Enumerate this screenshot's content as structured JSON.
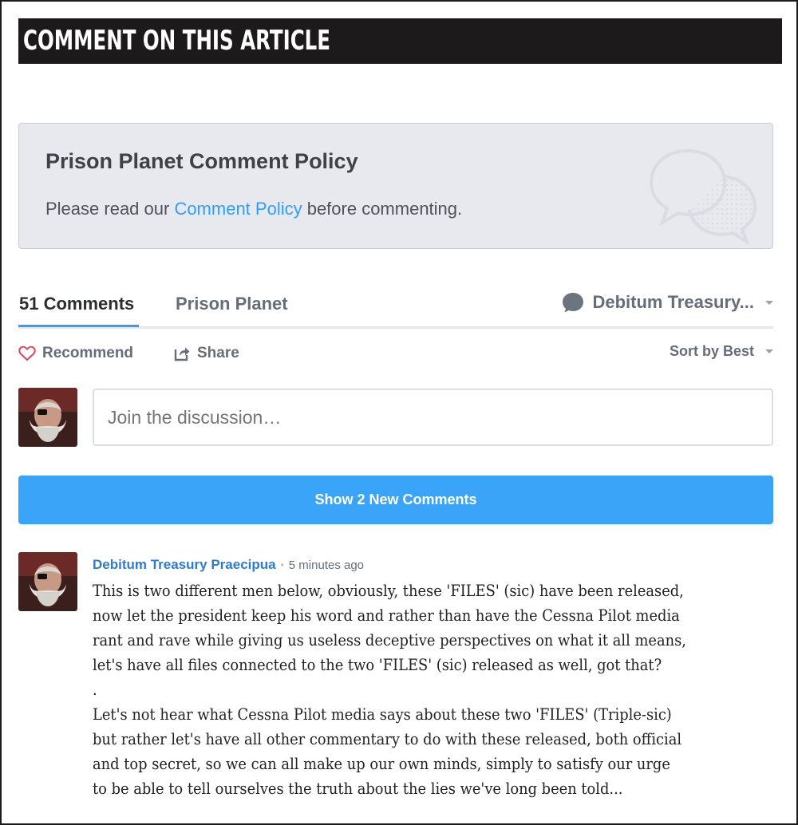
{
  "header": {
    "title": "COMMENT ON THIS ARTICLE"
  },
  "policy": {
    "title": "Prison Planet Comment Policy",
    "text_before": "Please read our ",
    "link": "Comment Policy",
    "text_after": " before commenting.",
    "icon": "speech-bubbles-icon"
  },
  "tabs": {
    "comments": "51 Comments",
    "community": "Prison Planet",
    "user": "Debitum Treasury..."
  },
  "actions": {
    "recommend": "Recommend",
    "share": "Share",
    "sort": "Sort by Best"
  },
  "composer": {
    "placeholder": "Join the discussion…"
  },
  "new_comments_button": "Show 2 New Comments",
  "post": {
    "author": "Debitum Treasury Praecipua",
    "separator": "•",
    "time": "5 minutes ago",
    "lines": [
      "This is two different men below, obviously, these 'FILES' (sic) have been released,",
      "now let the president keep his word and rather than have the Cessna Pilot media",
      "rant and rave while giving us useless deceptive perspectives on what it all means,",
      "let's have all files connected to the two 'FILES' (sic) released as well, got that?",
      ".",
      "Let's not hear what Cessna Pilot media says about these two 'FILES' (Triple-sic)",
      "but rather let's have all other commentary to do with these released, both official",
      "and top secret, so we can all make up our own minds, simply to satisfy our urge",
      "to be able to tell ourselves the truth about the lies we've long been told..."
    ]
  },
  "colors": {
    "accent": "#2e9fff",
    "button": "#3aa5f8",
    "author": "#2e7bd6",
    "header_bg": "#1c1a1b"
  }
}
